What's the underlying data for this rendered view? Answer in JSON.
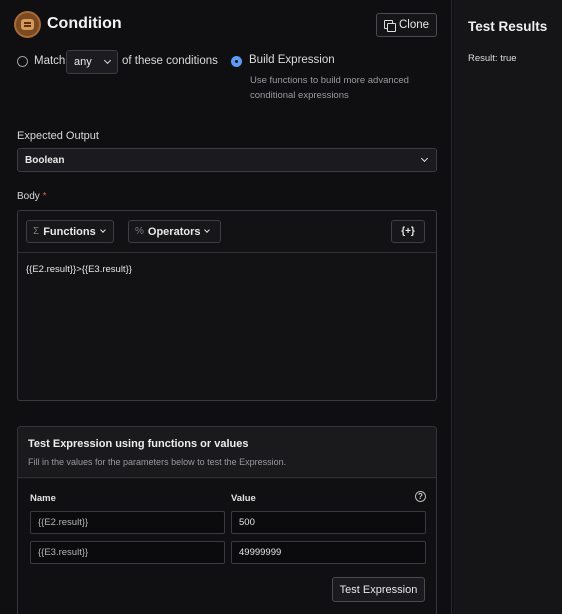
{
  "header": {
    "title": "Condition",
    "clone_label": "Clone"
  },
  "match": {
    "prefix": "Match",
    "selected": "any",
    "suffix": "of these conditions",
    "build_label": "Build Expression",
    "build_hint": "Use functions to build more advanced conditional expressions"
  },
  "expected_output": {
    "label": "Expected Output",
    "value": "Boolean"
  },
  "body": {
    "label": "Body",
    "required_mark": "*",
    "functions_label": "Functions",
    "functions_symbol": "Σ",
    "operators_label": "Operators",
    "operators_symbol": "%",
    "vars_label": "{+}",
    "expression": "{{E2.result}}>{{E3.result}}"
  },
  "test": {
    "title": "Test Expression using functions or values",
    "subtitle": "Fill in the values for the parameters below to test the Expression.",
    "col_name": "Name",
    "col_value": "Value",
    "help_symbol": "?",
    "rows": [
      {
        "name": "{{E2.result}}",
        "value": "500"
      },
      {
        "name": "{{E3.result}}",
        "value": "49999999"
      }
    ],
    "button_label": "Test Expression"
  },
  "results": {
    "title": "Test Results",
    "result": "Result: true"
  }
}
